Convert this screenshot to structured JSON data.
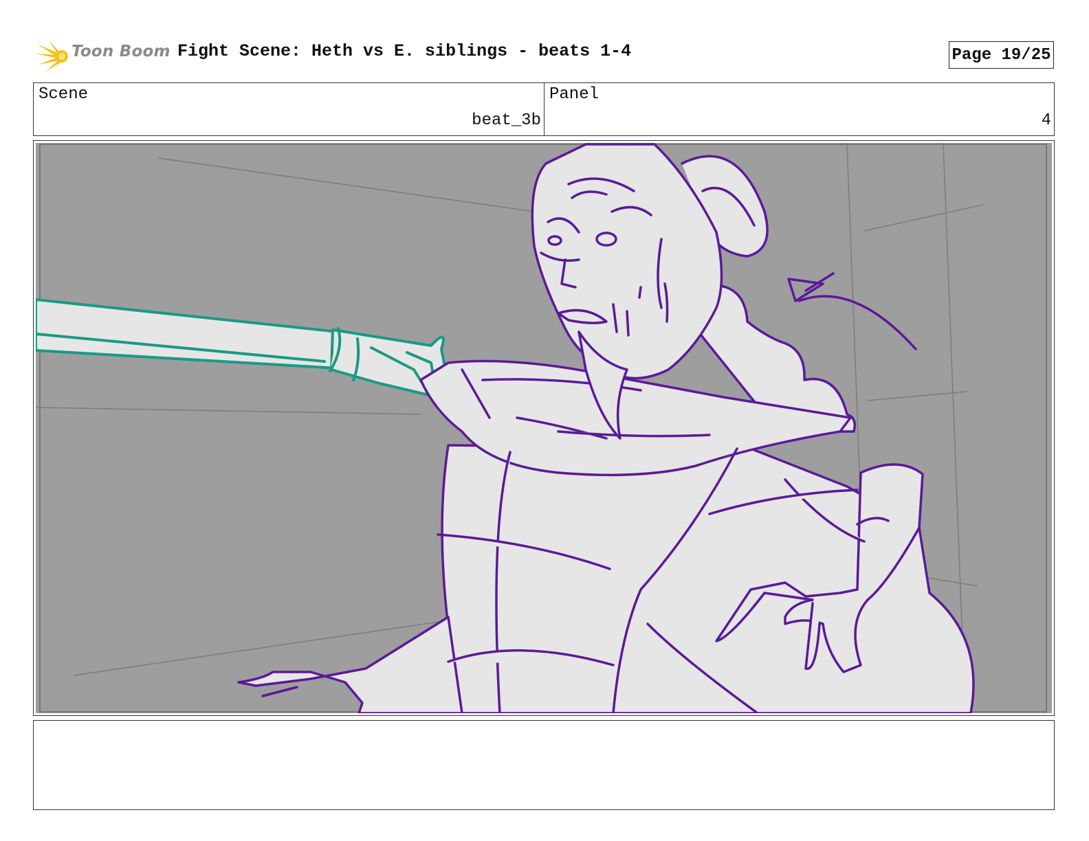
{
  "header": {
    "logo_text": "Toon Boom",
    "title": "Fight Scene: Heth vs E. siblings - beats 1-4",
    "page": "Page 19/25"
  },
  "info": {
    "scene_label": "Scene",
    "scene_value": "beat_3b",
    "panel_label": "Panel",
    "panel_value": "4"
  },
  "colors": {
    "character_line": "#5a1a9a",
    "sword_line": "#1a9a85",
    "background": "#9e9e9e",
    "fill": "#e6e6e6"
  },
  "notes": ""
}
